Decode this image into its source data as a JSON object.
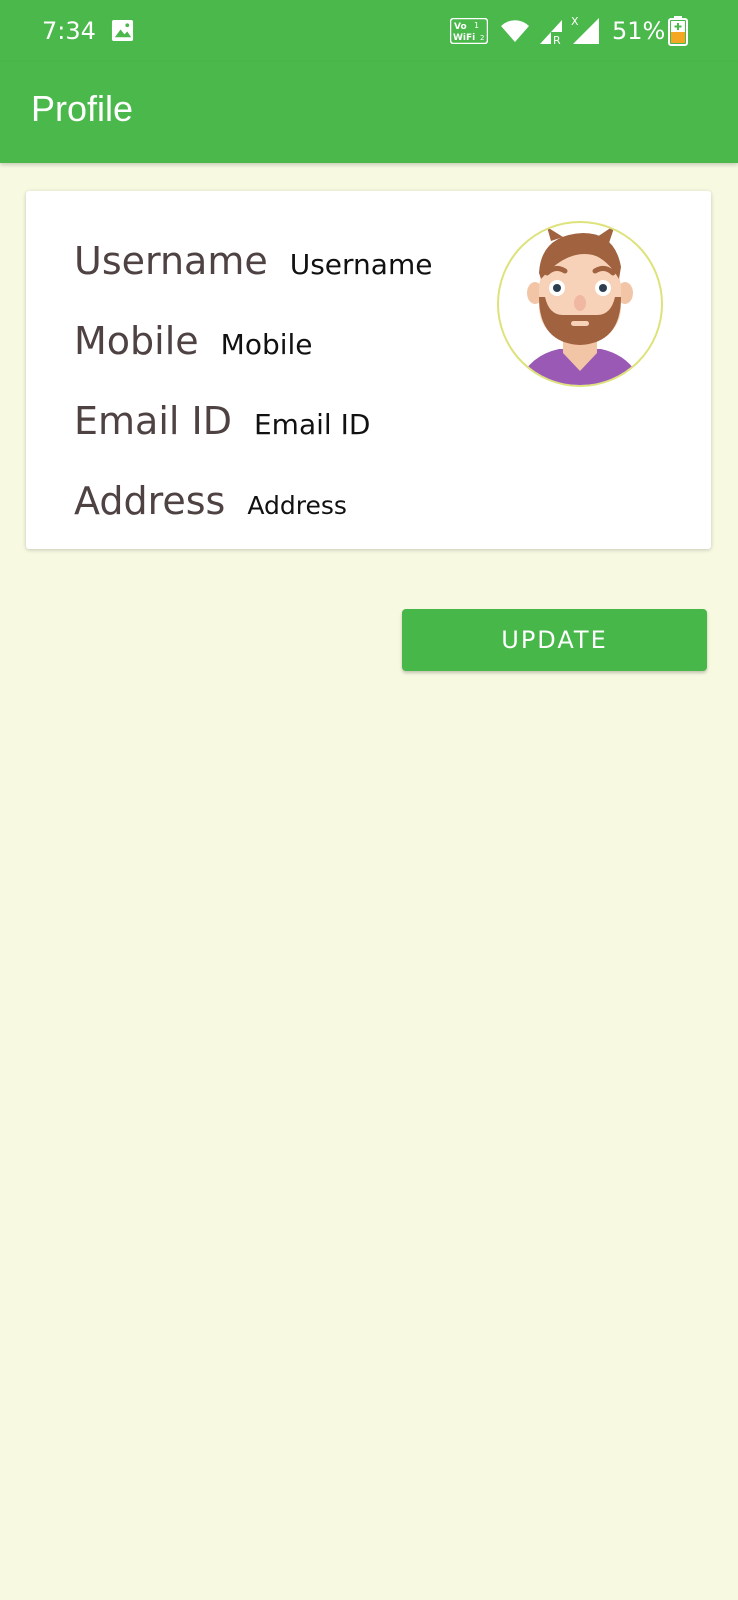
{
  "status_bar": {
    "time": "7:34",
    "gallery_icon": "image-icon",
    "vowifi_icon": "vowifi-icon",
    "wifi_icon": "wifi-icon",
    "signal_icons": [
      "signal-roaming-icon",
      "signal-no-data-icon"
    ],
    "battery_percent": "51%",
    "battery_icon": "battery-charging-icon"
  },
  "app_bar": {
    "title": "Profile",
    "color": "#4ab84b"
  },
  "profile_card": {
    "fields": [
      {
        "label": "Username",
        "value": "Username"
      },
      {
        "label": "Mobile",
        "value": "Mobile"
      },
      {
        "label": "Email ID",
        "value": "Email ID"
      },
      {
        "label": "Address",
        "value": "Address"
      }
    ],
    "avatar_icon": "bearded-man-avatar"
  },
  "actions": {
    "update_label": "UPDATE",
    "button_color": "#47b74a"
  },
  "colors": {
    "background": "#f7f9e1",
    "label_text": "#4e4243"
  }
}
